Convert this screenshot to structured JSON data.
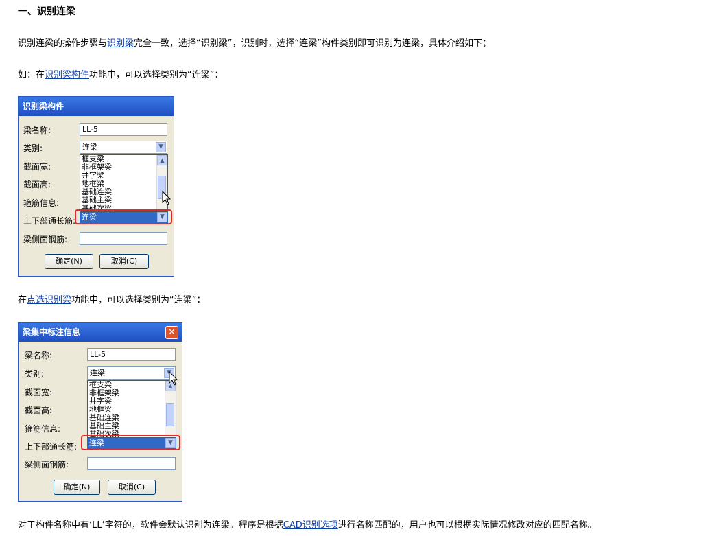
{
  "heading": "一、识别连梁",
  "para1": {
    "before": "识别连梁的操作步骤与",
    "link": "识别梁",
    "after": "完全一致，选择“识别梁”，识别时，选择“连梁”构件类别即可识别为连梁，具体介绍如下；"
  },
  "para2": {
    "before": "如：在",
    "link": "识别梁构件",
    "after": "功能中，可以选择类别为“连梁”："
  },
  "para3": {
    "before": "在",
    "link": "点选识别梁",
    "after": "功能中，可以选择类别为“连梁”："
  },
  "para4": {
    "before": "对于构件名称中有‘LL’字符的，软件会默认识别为连梁。程序是根据",
    "link": "CAD识别选项",
    "after": "进行名称匹配的，用户也可以根据实际情况修改对应的匹配名称。"
  },
  "dialog1": {
    "title": "识别梁构件",
    "labels": [
      "梁名称:",
      "类别:",
      "截面宽:",
      "截面高:",
      "箍筋信息:",
      "上下部通长筋:",
      "梁侧面钢筋:"
    ],
    "name_value": "LL-5",
    "category_value": "连梁",
    "options": [
      "框支梁",
      "非框架梁",
      "井字梁",
      "地框梁",
      "基础连梁",
      "基础主梁",
      "基础次梁"
    ],
    "selected_option": "连梁",
    "ok_label": "确定(N)",
    "cancel_label": "取消(C)"
  },
  "dialog2": {
    "title": "梁集中标注信息",
    "close_glyph": "✕",
    "labels": [
      "梁名称:",
      "类别:",
      "截面宽:",
      "截面高:",
      "箍筋信息:",
      "上下部通长筋:",
      "梁侧面钢筋:"
    ],
    "name_value": "LL-5",
    "category_value": "连梁",
    "options": [
      "框支梁",
      "非框架梁",
      "井字梁",
      "地框梁",
      "基础连梁",
      "基础主梁",
      "基础次梁"
    ],
    "selected_option": "连梁",
    "ok_label": "确定(N)",
    "cancel_label": "取消(C)"
  },
  "colors": {
    "link": "#0b3ea8",
    "title_bar": "#2a5fd6",
    "highlight_box": "#e02a2a",
    "selection": "#3169c6"
  }
}
